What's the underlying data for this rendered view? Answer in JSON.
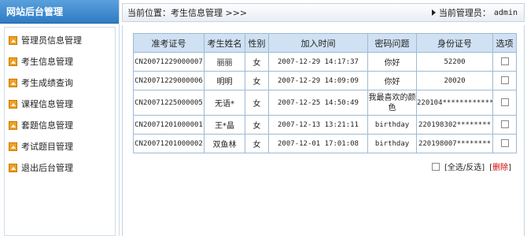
{
  "sidebar": {
    "title": "网站后台管理",
    "items": [
      {
        "label": "管理员信息管理"
      },
      {
        "label": "考生信息管理"
      },
      {
        "label": "考生成绩查询"
      },
      {
        "label": "课程信息管理"
      },
      {
        "label": "套题信息管理"
      },
      {
        "label": "考试题目管理"
      },
      {
        "label": "退出后台管理"
      }
    ]
  },
  "header": {
    "location_label": "当前位置：",
    "location_page": "考生信息管理",
    "location_arrows": ">>>",
    "admin_label": "当前管理员：",
    "admin_name": "admin"
  },
  "table": {
    "columns": [
      "准考证号",
      "考生姓名",
      "性别",
      "加入时间",
      "密码问题",
      "身份证号",
      "选项"
    ],
    "rows": [
      {
        "id": "CN20071229000007",
        "name": "丽丽",
        "sex": "女",
        "time": "2007-12-29 14:17:37",
        "question": "你好",
        "idcard": "52200"
      },
      {
        "id": "CN20071229000006",
        "name": "明明",
        "sex": "女",
        "time": "2007-12-29 14:09:09",
        "question": "你好",
        "idcard": "20020"
      },
      {
        "id": "CN20071225000005",
        "name": "无语*",
        "sex": "女",
        "time": "2007-12-25 14:50:49",
        "question": "我最喜欢的颜色",
        "idcard": "220104************"
      },
      {
        "id": "CN20071201000001",
        "name": "王*晶",
        "sex": "女",
        "time": "2007-12-13 13:21:11",
        "question": "birthday",
        "idcard": "220198302********"
      },
      {
        "id": "CN20071201000002",
        "name": "双鱼林",
        "sex": "女",
        "time": "2007-12-01 17:01:08",
        "question": "birthday",
        "idcard": "220198007********"
      }
    ]
  },
  "actions": {
    "select_all": "[全选/反选]",
    "delete_open": "[",
    "delete_label": "删除",
    "delete_close": "]"
  },
  "colors": {
    "sidebar_header": "#2f7bc4",
    "table_header_bg": "#cfe1f3",
    "table_border": "#9fb9d4",
    "delete_link": "#cc0000",
    "menu_icon": "#f0a020"
  }
}
